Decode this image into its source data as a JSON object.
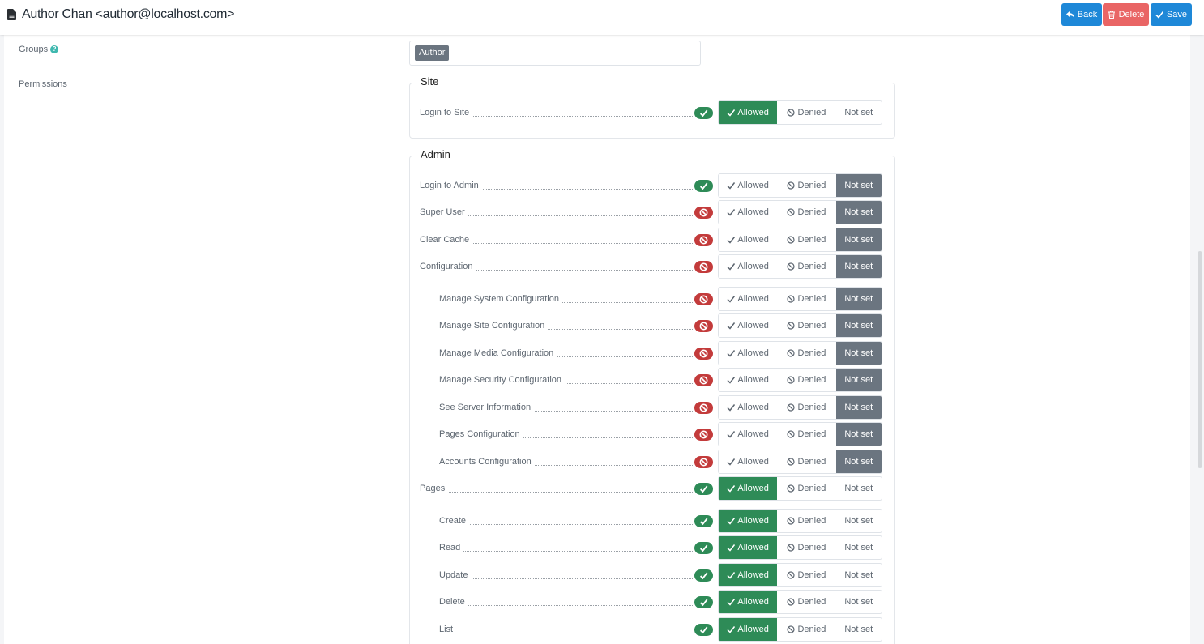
{
  "header": {
    "title": "Author Chan <author@localhost.com>",
    "back_label": "Back",
    "delete_label": "Delete",
    "save_label": "Save"
  },
  "form": {
    "groups_label": "Groups",
    "groups_help": "?",
    "groups_tag": "Author",
    "permissions_label": "Permissions"
  },
  "options": {
    "allowed": "Allowed",
    "denied": "Denied",
    "not_set": "Not set"
  },
  "colors": {
    "primary": "#1e88d8",
    "danger": "#e96565",
    "success": "#2e8b57",
    "muted": "#6b7580",
    "error": "#c33b3b"
  },
  "site": {
    "legend": "Site",
    "rows": [
      {
        "label": "Login to Site",
        "status": "allowed",
        "value": "allowed",
        "indent": false
      }
    ]
  },
  "admin": {
    "legend": "Admin",
    "rows": [
      {
        "label": "Login to Admin",
        "status": "allowed",
        "value": "not_set",
        "indent": false
      },
      {
        "label": "Super User",
        "status": "denied",
        "value": "not_set",
        "indent": false
      },
      {
        "label": "Clear Cache",
        "status": "denied",
        "value": "not_set",
        "indent": false
      },
      {
        "label": "Configuration",
        "status": "denied",
        "value": "not_set",
        "indent": false
      },
      {
        "label": "Manage System Configuration",
        "status": "denied",
        "value": "not_set",
        "indent": true
      },
      {
        "label": "Manage Site Configuration",
        "status": "denied",
        "value": "not_set",
        "indent": true
      },
      {
        "label": "Manage Media Configuration",
        "status": "denied",
        "value": "not_set",
        "indent": true
      },
      {
        "label": "Manage Security Configuration",
        "status": "denied",
        "value": "not_set",
        "indent": true
      },
      {
        "label": "See Server Information",
        "status": "denied",
        "value": "not_set",
        "indent": true
      },
      {
        "label": "Pages Configuration",
        "status": "denied",
        "value": "not_set",
        "indent": true
      },
      {
        "label": "Accounts Configuration",
        "status": "denied",
        "value": "not_set",
        "indent": true
      },
      {
        "label": "Pages",
        "status": "allowed",
        "value": "allowed",
        "indent": false
      },
      {
        "label": "Create",
        "status": "allowed",
        "value": "allowed",
        "indent": true
      },
      {
        "label": "Read",
        "status": "allowed",
        "value": "allowed",
        "indent": true
      },
      {
        "label": "Update",
        "status": "allowed",
        "value": "allowed",
        "indent": true
      },
      {
        "label": "Delete",
        "status": "allowed",
        "value": "allowed",
        "indent": true
      },
      {
        "label": "List",
        "status": "allowed",
        "value": "allowed",
        "indent": true
      }
    ]
  }
}
